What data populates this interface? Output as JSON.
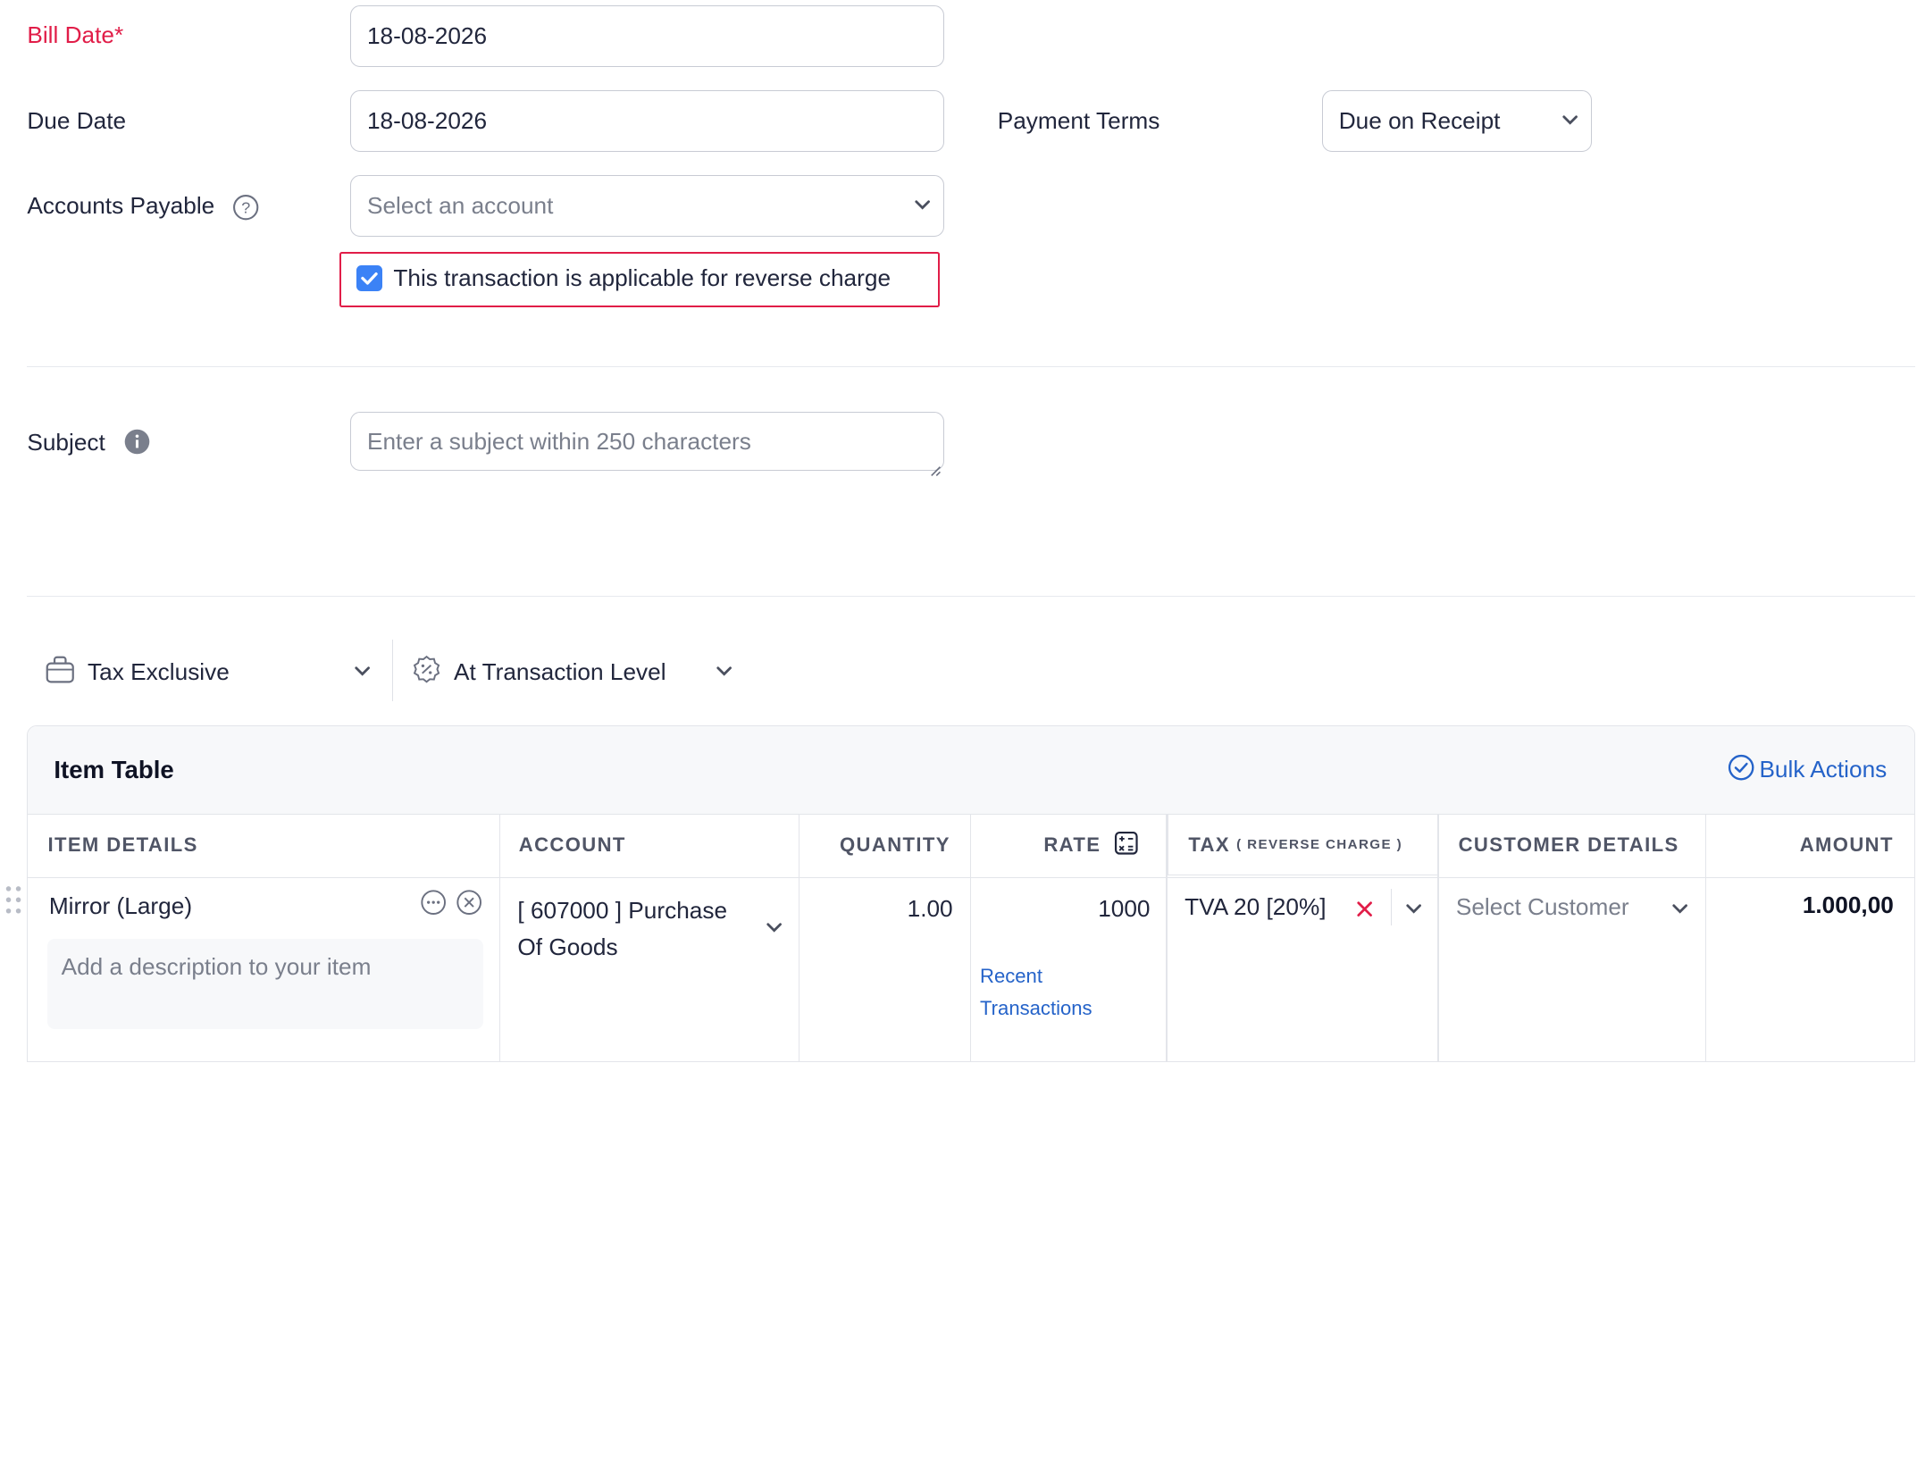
{
  "form": {
    "bill_date_label": "Bill Date*",
    "bill_date_value": "18-08-2026",
    "due_date_label": "Due Date",
    "due_date_value": "18-08-2026",
    "payment_terms_label": "Payment Terms",
    "payment_terms_value": "Due on Receipt",
    "accounts_payable_label": "Accounts Payable",
    "accounts_payable_placeholder": "Select an account",
    "reverse_charge_label": "This transaction is applicable for reverse charge",
    "reverse_charge_checked": true,
    "subject_label": "Subject",
    "subject_placeholder": "Enter a subject within 250 characters"
  },
  "tax_options": {
    "tax_mode": "Tax Exclusive",
    "tax_level": "At Transaction Level"
  },
  "item_table": {
    "title": "Item Table",
    "bulk_actions": "Bulk Actions",
    "columns": {
      "item_details": "ITEM DETAILS",
      "account": "ACCOUNT",
      "quantity": "QUANTITY",
      "rate": "RATE",
      "tax": "TAX",
      "tax_sub": "( REVERSE CHARGE )",
      "customer_details": "CUSTOMER DETAILS",
      "amount": "AMOUNT"
    },
    "rows": [
      {
        "item": "Mirror (Large)",
        "description_placeholder": "Add a description to your item",
        "account_line1": "[ 607000 ] Purchase",
        "account_line2": "Of Goods",
        "quantity": "1.00",
        "rate": "1000",
        "recent_line1": "Recent",
        "recent_line2": "Transactions",
        "tax": "TVA 20 [20%]",
        "customer_placeholder": "Select Customer",
        "amount": "1.000,00"
      }
    ]
  },
  "colors": {
    "required": "#e11d48",
    "link": "#2563c9",
    "checkbox": "#3b82f6",
    "highlight_border": "#e11d48"
  }
}
